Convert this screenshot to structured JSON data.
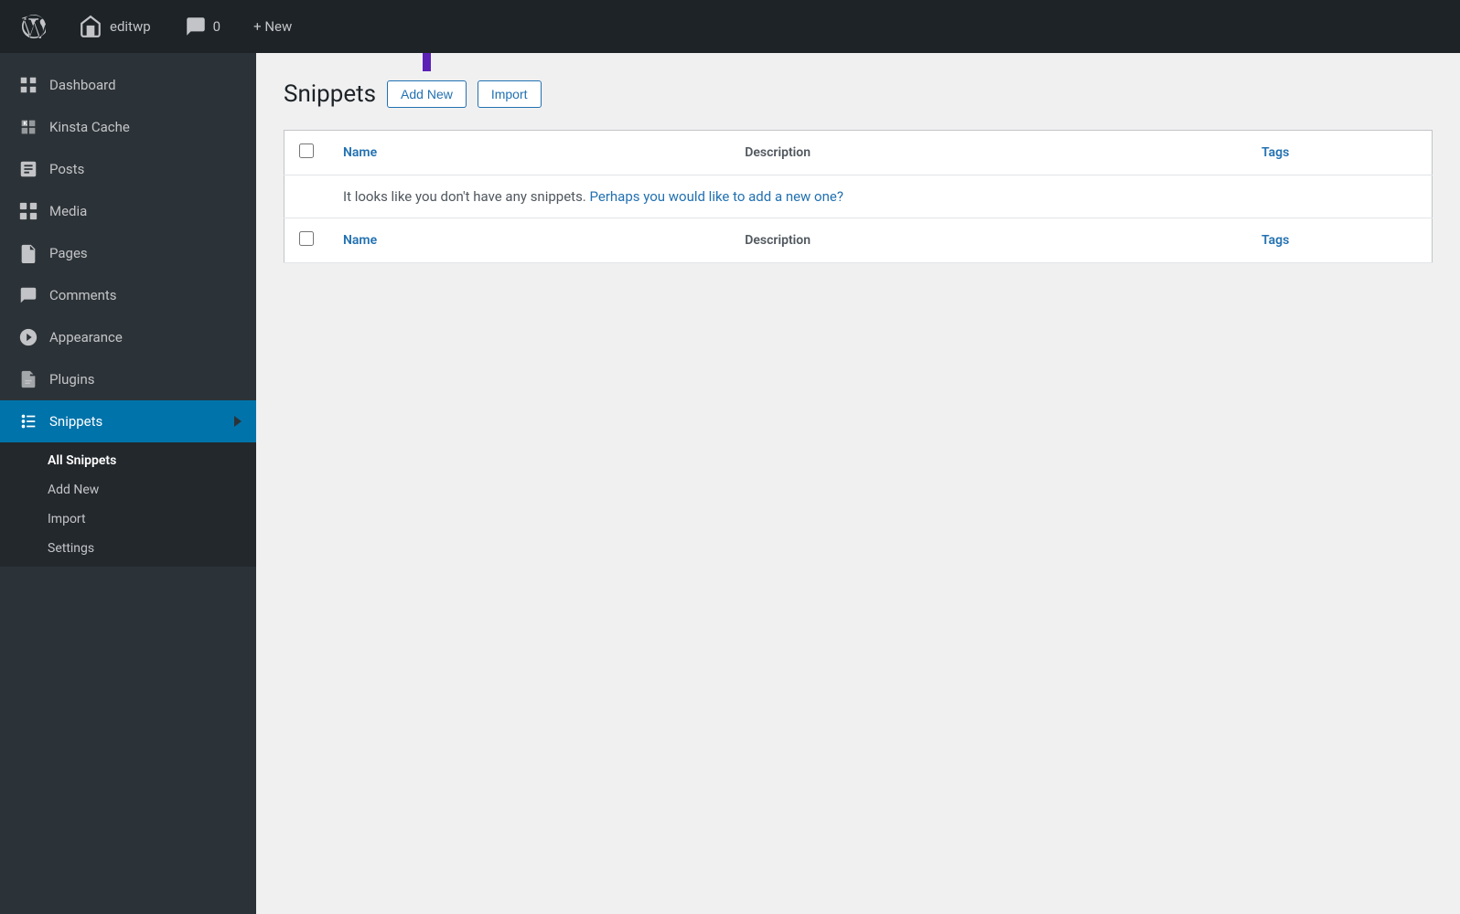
{
  "adminBar": {
    "wpIcon": "wordpress-icon",
    "siteLabel": "editwp",
    "commentsIcon": "comments-icon",
    "commentsCount": "0",
    "newLabel": "+ New"
  },
  "sidebar": {
    "items": [
      {
        "id": "dashboard",
        "label": "Dashboard",
        "icon": "dashboard-icon"
      },
      {
        "id": "kinsta-cache",
        "label": "Kinsta Cache",
        "icon": "kinsta-icon"
      },
      {
        "id": "posts",
        "label": "Posts",
        "icon": "posts-icon"
      },
      {
        "id": "media",
        "label": "Media",
        "icon": "media-icon"
      },
      {
        "id": "pages",
        "label": "Pages",
        "icon": "pages-icon"
      },
      {
        "id": "comments",
        "label": "Comments",
        "icon": "comments-icon"
      },
      {
        "id": "appearance",
        "label": "Appearance",
        "icon": "appearance-icon"
      },
      {
        "id": "plugins",
        "label": "Plugins",
        "icon": "plugins-icon"
      },
      {
        "id": "snippets",
        "label": "Snippets",
        "icon": "snippets-icon",
        "active": true
      }
    ],
    "submenu": [
      {
        "id": "all-snippets",
        "label": "All Snippets",
        "active": true
      },
      {
        "id": "add-new",
        "label": "Add New"
      },
      {
        "id": "import",
        "label": "Import"
      },
      {
        "id": "settings",
        "label": "Settings"
      }
    ]
  },
  "content": {
    "pageTitle": "Snippets",
    "addNewBtn": "Add New",
    "importBtn": "Import",
    "table": {
      "columns": [
        {
          "id": "name",
          "label": "Name"
        },
        {
          "id": "description",
          "label": "Description"
        },
        {
          "id": "tags",
          "label": "Tags"
        }
      ],
      "emptyMessage": "It looks like you don't have any snippets.",
      "emptyLink": "Perhaps you would like to add a new one?"
    }
  }
}
